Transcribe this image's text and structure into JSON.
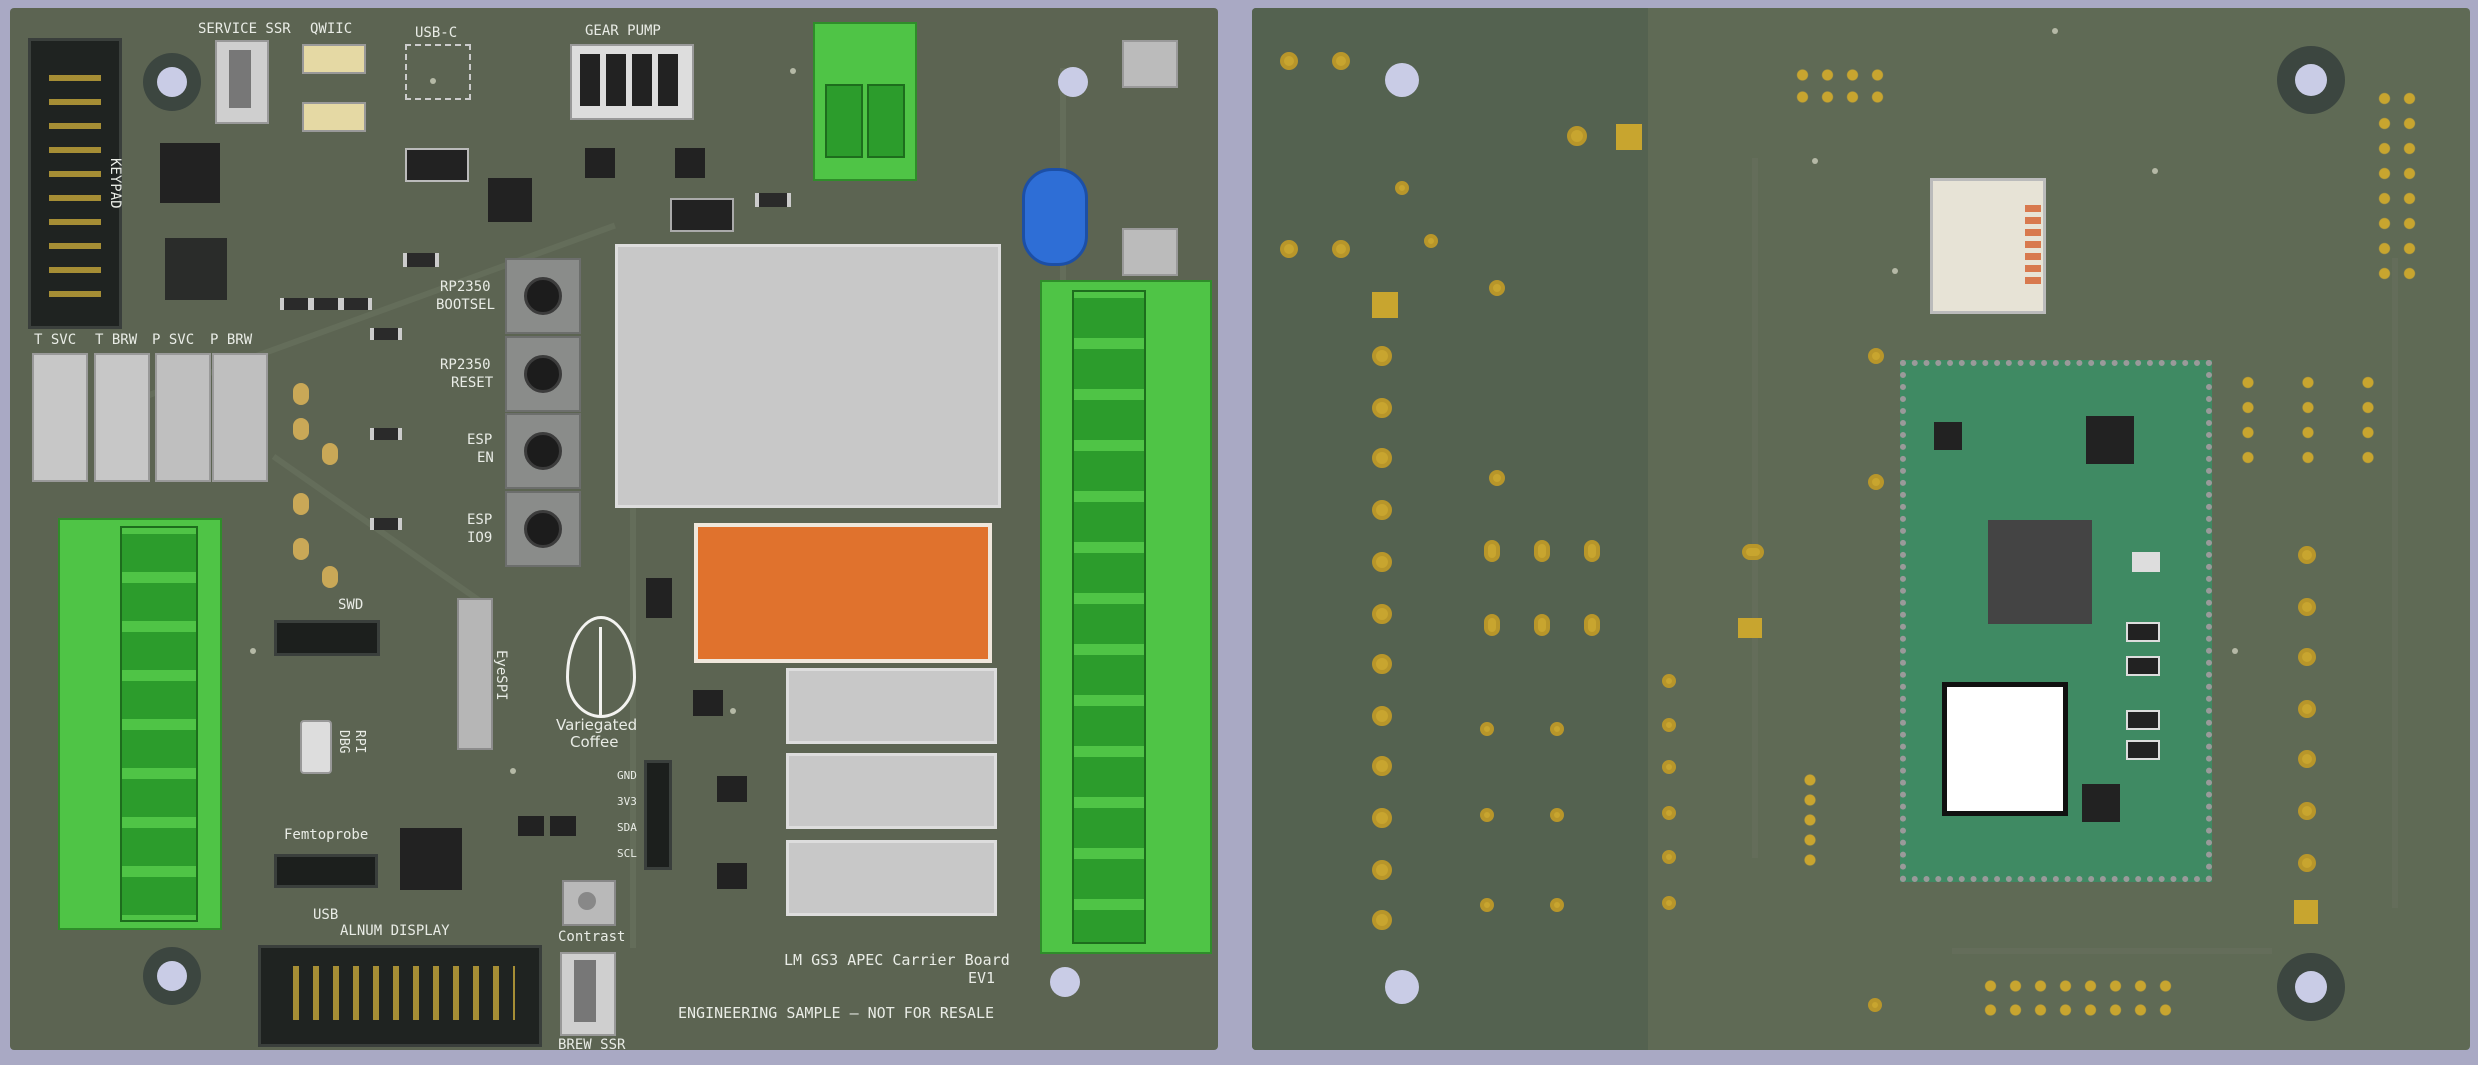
{
  "front": {
    "labels": {
      "keypad": "KEYPAD",
      "service_ssr": "SERVICE SSR",
      "qwiic": "QWIIC",
      "usb_c": "USB-C",
      "gear_pump": "GEAR PUMP",
      "t_svc": "T SVC",
      "t_brw": "T BRW",
      "p_svc": "P SVC",
      "p_brw": "P BRW",
      "bootsel_1": "RP2350",
      "bootsel_2": "BOOTSEL",
      "reset_1": "RP2350",
      "reset_2": "RESET",
      "esp_en_1": "ESP",
      "esp_en_2": "EN",
      "esp_io9_1": "ESP",
      "esp_io9_2": "IO9",
      "swd": "SWD",
      "eyespi": "EyeSPI",
      "rpi_dbg_1": "RPI",
      "rpi_dbg_2": "DBG",
      "femtoprobe": "Femtoprobe",
      "usb": "USB",
      "alnum_display": "ALNUM DISPLAY",
      "contrast": "Contrast",
      "brew_ssr": "BREW SSR",
      "gnd": "GND",
      "v3": "3V3",
      "sda": "SDA",
      "scl": "SCL",
      "logo_1": "Variegated",
      "logo_2": "Coffee",
      "board_title": "LM GS3 APEC Carrier Board",
      "board_rev": "EV1",
      "engineering": "ENGINEERING SAMPLE — NOT FOR RESALE"
    }
  },
  "colors": {
    "pcb_front": "#5c6452",
    "pcb_back": "#5f6a55",
    "terminal_green": "#4fc446",
    "relay_orange": "#e0722d",
    "cap_blue": "#2e6ed6",
    "module_green": "#3f8a63",
    "gold": "#c8a52f"
  }
}
